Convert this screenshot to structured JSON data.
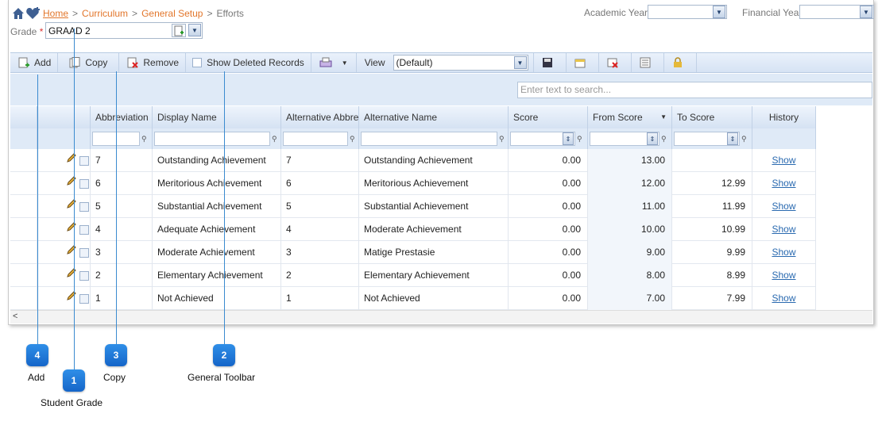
{
  "breadcrumb": {
    "home": "Home",
    "sep": ">",
    "curriculum": "Curriculum",
    "setup": "General Setup",
    "current": "Efforts"
  },
  "header": {
    "academic_year_label": "Academic Year",
    "financial_year_label": "Financial Year"
  },
  "grade": {
    "label": "Grade",
    "required": "*",
    "value": "GRAAD  2"
  },
  "toolbar": {
    "add": "Add",
    "copy": "Copy",
    "remove": "Remove",
    "show_deleted": "Show Deleted Records",
    "view_label": "View",
    "view_value": "(Default)"
  },
  "search": {
    "placeholder": "Enter text to search..."
  },
  "columns": [
    "Abbreviation",
    "Display Name",
    "Alternative Abbre",
    "Alternative Name",
    "Score",
    "From Score",
    "To Score",
    "History"
  ],
  "rows": [
    {
      "abbr": "7",
      "name": "Outstanding Achievement",
      "alt_abbr": "7",
      "alt_name": "Outstanding Achievement",
      "score": "0.00",
      "from": "13.00",
      "to": "",
      "history": "Show"
    },
    {
      "abbr": "6",
      "name": "Meritorious Achievement",
      "alt_abbr": "6",
      "alt_name": "Meritorious Achievement",
      "score": "0.00",
      "from": "12.00",
      "to": "12.99",
      "history": "Show"
    },
    {
      "abbr": "5",
      "name": "Substantial Achievement",
      "alt_abbr": "5",
      "alt_name": "Substantial Achievement",
      "score": "0.00",
      "from": "11.00",
      "to": "11.99",
      "history": "Show"
    },
    {
      "abbr": "4",
      "name": "Adequate Achievement",
      "alt_abbr": "4",
      "alt_name": "Moderate Achievement",
      "score": "0.00",
      "from": "10.00",
      "to": "10.99",
      "history": "Show"
    },
    {
      "abbr": "3",
      "name": "Moderate Achievement",
      "alt_abbr": "3",
      "alt_name": "Matige Prestasie",
      "score": "0.00",
      "from": "9.00",
      "to": "9.99",
      "history": "Show"
    },
    {
      "abbr": "2",
      "name": "Elementary Achievement",
      "alt_abbr": "2",
      "alt_name": "Elementary Achievement",
      "score": "0.00",
      "from": "8.00",
      "to": "8.99",
      "history": "Show"
    },
    {
      "abbr": "1",
      "name": "Not Achieved",
      "alt_abbr": "1",
      "alt_name": "Not Achieved",
      "score": "0.00",
      "from": "7.00",
      "to": "7.99",
      "history": "Show"
    }
  ],
  "callouts": [
    {
      "num": "4",
      "label": "Add"
    },
    {
      "num": "1",
      "label": "Student Grade"
    },
    {
      "num": "3",
      "label": "Copy"
    },
    {
      "num": "2",
      "label": "General Toolbar"
    }
  ],
  "icons": [
    "home-icon",
    "favorite-icon",
    "add-icon",
    "copy-icon",
    "remove-icon",
    "checkbox-icon",
    "print-icon",
    "save-icon",
    "export-icon",
    "clear-icon",
    "columns-icon",
    "lock-icon",
    "edit-icon",
    "filter-icon"
  ],
  "colors": {
    "link": "#e2762b",
    "accent": "#1565c8",
    "header_bg": "#d6e3f4"
  }
}
